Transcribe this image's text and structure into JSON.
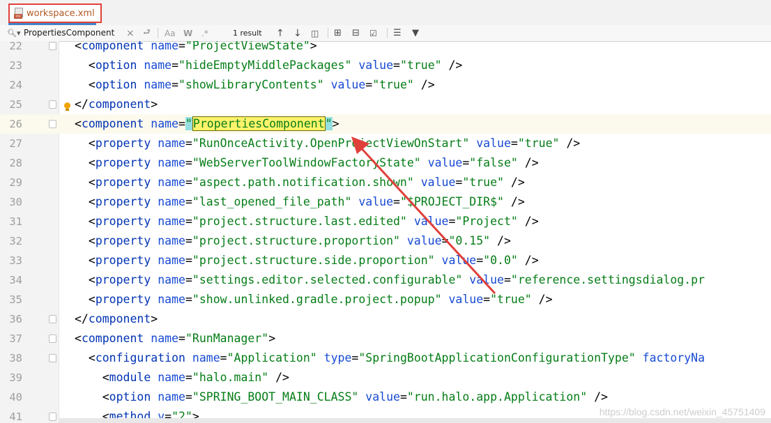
{
  "tab": {
    "title": "workspace.xml",
    "icon_badge": "<>"
  },
  "search": {
    "value": "PropertiesComponent",
    "clear": "×",
    "match_case": "Aa",
    "words": "W",
    "regex": ".*",
    "results": "1 result"
  },
  "editor": {
    "lines": [
      {
        "n": "22"
      },
      {
        "n": "23"
      },
      {
        "n": "24"
      },
      {
        "n": "25"
      },
      {
        "n": "26"
      },
      {
        "n": "27"
      },
      {
        "n": "28"
      },
      {
        "n": "29"
      },
      {
        "n": "30"
      },
      {
        "n": "31"
      },
      {
        "n": "32"
      },
      {
        "n": "33"
      },
      {
        "n": "34"
      },
      {
        "n": "35"
      },
      {
        "n": "36"
      },
      {
        "n": "37"
      },
      {
        "n": "38"
      },
      {
        "n": "39"
      },
      {
        "n": "40"
      },
      {
        "n": "41"
      }
    ]
  },
  "tokens": {
    "component": "component",
    "option": "option",
    "property": "property",
    "configuration": "configuration",
    "module": "module",
    "method": "method",
    "name": "name",
    "value": "value",
    "type": "type",
    "factory": "factoryNa",
    "v": "v"
  },
  "strings": {
    "l22": "\"ProjectViewState\"",
    "l23n": "\"hideEmptyMiddlePackages\"",
    "l23v": "\"true\"",
    "l24n": "\"showLibraryContents\"",
    "l24v": "\"true\"",
    "l26n": "PropertiesComponent",
    "l27n": "\"RunOnceActivity.OpenProjectViewOnStart\"",
    "l27v": "\"true\"",
    "l28n": "\"WebServerToolWindowFactoryState\"",
    "l28v": "\"false\"",
    "l29n": "\"aspect.path.notification.shown\"",
    "l29v": "\"true\"",
    "l30n": "\"last_opened_file_path\"",
    "l30v": "\"$PROJECT_DIR$\"",
    "l31n": "\"project.structure.last.edited\"",
    "l31v": "\"Project\"",
    "l32n": "\"project.structure.proportion\"",
    "l32v": "\"0.15\"",
    "l33n": "\"project.structure.side.proportion\"",
    "l33v": "\"0.0\"",
    "l34n": "\"settings.editor.selected.configurable\"",
    "l34v": "\"reference.settingsdialog.pr",
    "l35n": "\"show.unlinked.gradle.project.popup\"",
    "l35v": "\"true\"",
    "l37n": "\"RunManager\"",
    "l38n": "\"Application\"",
    "l38t": "\"SpringBootApplicationConfigurationType\"",
    "l39n": "\"halo.main\"",
    "l40n": "\"SPRING_BOOT_MAIN_CLASS\"",
    "l40v": "\"run.halo.app.Application\"",
    "l41v": "\"2\""
  },
  "watermark": "https://blog.csdn.net/weixin_45751409",
  "colors": {
    "tag": "#0033b3",
    "string": "#067d17",
    "highlight": "#fff36b",
    "annotation": "#e0403a"
  }
}
